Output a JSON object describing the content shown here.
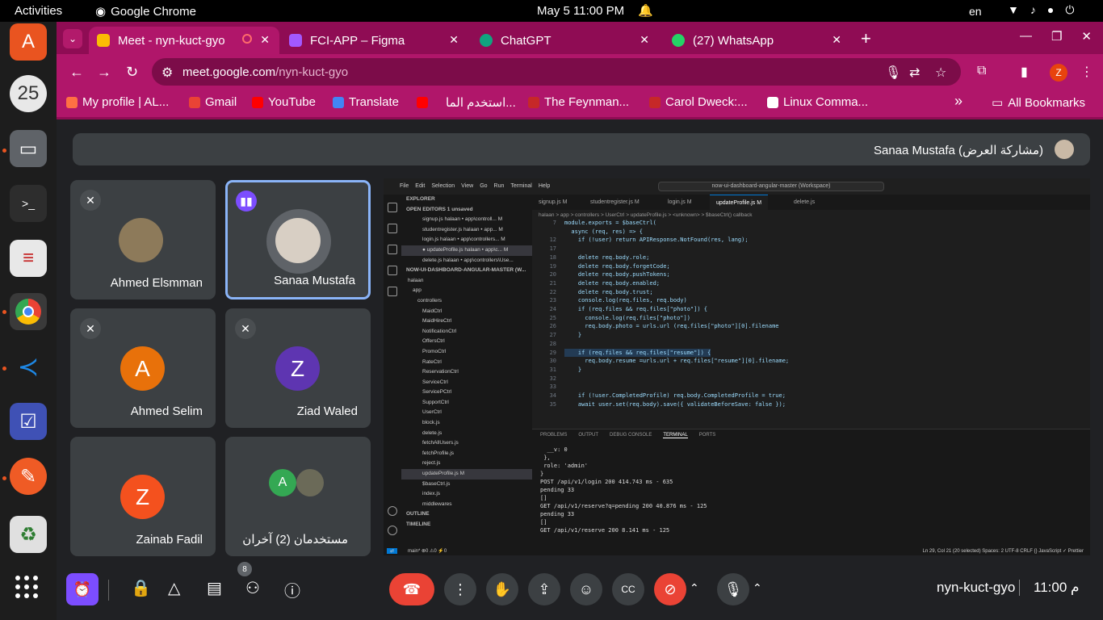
{
  "system": {
    "activities": "Activities",
    "app_name": "Google Chrome",
    "clock": "May 5  11:00 PM",
    "lang": "en"
  },
  "tabs": [
    {
      "title": "Meet - nyn-kuct-gyo",
      "color": "#fbbc04"
    },
    {
      "title": "FCI-APP – Figma",
      "color": "#a259ff"
    },
    {
      "title": "ChatGPT",
      "color": "#10a37f"
    },
    {
      "title": "(27) WhatsApp",
      "color": "#25d366"
    }
  ],
  "omnibox": {
    "host": "meet.google.com",
    "path": "/nyn-kuct-gyo"
  },
  "bookmarks": [
    {
      "label": "My profile | AL...",
      "color": "#ff7043"
    },
    {
      "label": "Gmail",
      "color": "#ea4335"
    },
    {
      "label": "YouTube",
      "color": "#ff0000"
    },
    {
      "label": "Translate",
      "color": "#4285f4"
    },
    {
      "label": "استخدم الما...",
      "color": "#ff0000"
    },
    {
      "label": "The Feynman...",
      "color": "#c62828"
    },
    {
      "label": "Carol Dweck:...",
      "color": "#c62828"
    },
    {
      "label": "Linux Comma...",
      "color": "#ffffff"
    },
    {
      "label": "All Bookmarks",
      "color": "#ffffff"
    }
  ],
  "presenter": {
    "label": "Sanaa Mustafa (مشاركة العرض)"
  },
  "participants": [
    {
      "name": "Ahmed Elsmman",
      "initial": "",
      "color": "#8d7a5a",
      "muted": true
    },
    {
      "name": "Sanaa Mustafa",
      "initial": "",
      "color": "#d8cfc4",
      "muted": false
    },
    {
      "name": "Ahmed Selim",
      "initial": "A",
      "color": "#e8710a",
      "muted": true
    },
    {
      "name": "Ziad Waled",
      "initial": "Z",
      "color": "#5e35b1",
      "muted": true
    },
    {
      "name": "Zainab Fadil",
      "initial": "Z",
      "color": "#f4511e",
      "muted": false
    },
    {
      "name": "مستخدمان (2) آخران",
      "initial": "A",
      "color": "#34a853",
      "muted": false
    }
  ],
  "vscode": {
    "menu": [
      "File",
      "Edit",
      "Selection",
      "View",
      "Go",
      "Run",
      "Terminal",
      "Help"
    ],
    "search": "now-ui-dashboard-angular-master (Workspace)",
    "tabs": [
      "signup.js M",
      "studentregister.js M",
      "login.js M",
      "updateProfile.js M",
      "delete.js"
    ],
    "breadcrumb": "halaan > app > controllers > UserCtrl > updateProfile.js > <unknown> > $baseCtrl() callback",
    "sidebar": [
      "EXPLORER",
      "OPEN EDITORS  1 unsaved",
      "signup.js  halaan • app\\controll...  M",
      "studentregister.js  halaan • app...  M",
      "login.js  halaan • app\\controllers...  M",
      "● updateProfile.js  halaan • app\\c...  M",
      "delete.js  halaan • app\\controllers\\Use...",
      "NOW-UI-DASHBOARD-ANGULAR-MASTER (W...",
      "halaan",
      "app",
      "controllers",
      "MaidCtrl",
      "MaidHireCtrl",
      "NotificationCtrl",
      "OffersCtrl",
      "PromoCtrl",
      "RateCtrl",
      "ReservationCtrl",
      "ServiceCtrl",
      "ServicePCtrl",
      "SupportCtrl",
      "UserCtrl",
      "block.js",
      "delete.js",
      "fetchAllUsers.js",
      "fetchProfile.js",
      "reject.js",
      "updateProfile.js  M",
      "$baseCtrl.js",
      "index.js",
      "middlewares",
      "OUTLINE",
      "TIMELINE"
    ],
    "code": [
      {
        "n": "7",
        "t": "module.exports = $baseCtrl("
      },
      {
        "n": "",
        "t": "  async (req, res) => {"
      },
      {
        "n": "12",
        "t": "    if (!user) return APIResponse.NotFound(res, lang);"
      },
      {
        "n": "17",
        "t": ""
      },
      {
        "n": "18",
        "t": "    delete req.body.role;"
      },
      {
        "n": "19",
        "t": "    delete req.body.forgetCode;"
      },
      {
        "n": "20",
        "t": "    delete req.body.pushTokens;"
      },
      {
        "n": "21",
        "t": "    delete req.body.enabled;"
      },
      {
        "n": "22",
        "t": "    delete req.body.trust;"
      },
      {
        "n": "23",
        "t": "    console.log(req.files, req.body)"
      },
      {
        "n": "24",
        "t": "    if (req.files && req.files[\"photo\"]) {"
      },
      {
        "n": "25",
        "t": "      console.log(req.files[\"photo\"])"
      },
      {
        "n": "26",
        "t": "      req.body.photo = urls.url (req.files[\"photo\"][0].filename"
      },
      {
        "n": "27",
        "t": "    }"
      },
      {
        "n": "28",
        "t": ""
      },
      {
        "n": "29",
        "t": "    if (req.files && req.files[\"resume\"]) {"
      },
      {
        "n": "30",
        "t": "      req.body.resume =urls.url + req.files[\"resume\"][0].filename;"
      },
      {
        "n": "31",
        "t": "    }"
      },
      {
        "n": "32",
        "t": ""
      },
      {
        "n": "33",
        "t": ""
      },
      {
        "n": "34",
        "t": "    if (!user.CompletedProfile) req.body.CompletedProfile = true;"
      },
      {
        "n": "35",
        "t": "    await user.set(req.body).save({ validateBeforeSave: false });"
      }
    ],
    "panel_tabs": [
      "PROBLEMS",
      "OUTPUT",
      "DEBUG CONSOLE",
      "TERMINAL",
      "PORTS"
    ],
    "terminal": [
      "  __v: 0",
      " },",
      " role: 'admin'",
      "}",
      "POST /api/v1/login 200 414.743 ms - 635",
      "pending 33",
      "[]",
      "GET /api/v1/reserve?q=pending 200 40.876 ms - 125",
      "pending 33",
      "[]",
      "GET /api/v1/reserve 200 8.141 ms - 125"
    ],
    "status_left": "main*  ⊗0 ⚠0  ⚡0",
    "status_right": "Ln 29, Col 21 (20 selected)   Spaces: 2   UTF-8   CRLF   {} JavaScript   ✓ Prettier"
  },
  "controls": {
    "people_count": "8",
    "meeting_code": "nyn-kuct-gyo",
    "time": "11:00 م"
  }
}
